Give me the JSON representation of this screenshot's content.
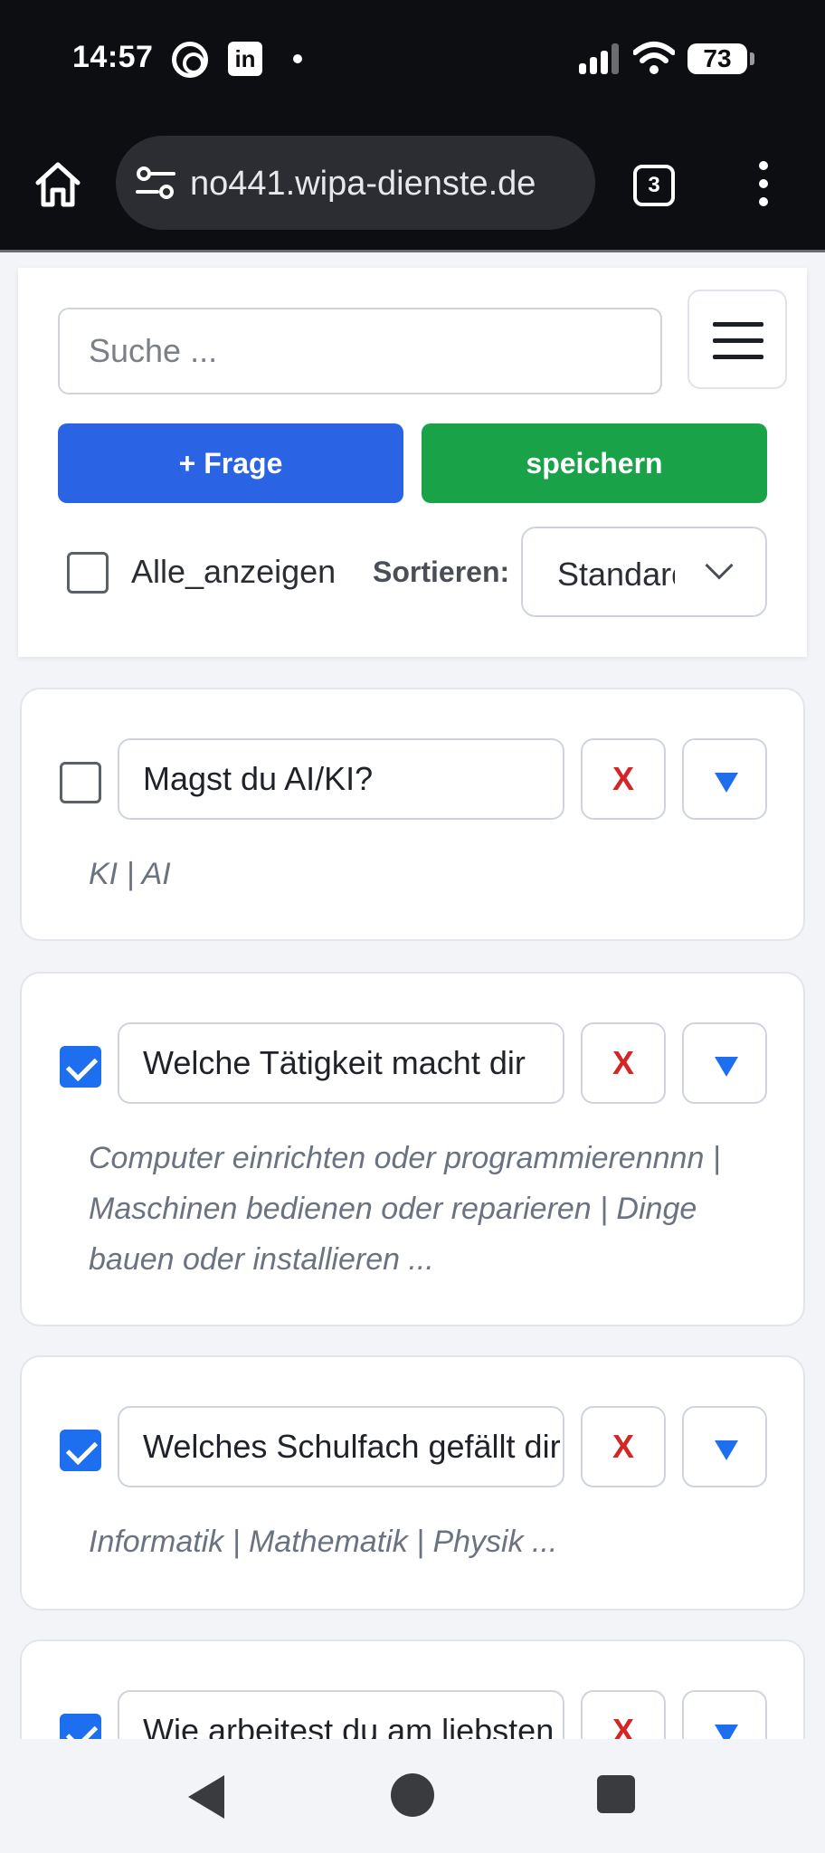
{
  "status_bar": {
    "time": "14:57",
    "battery": "73",
    "icons": [
      "threads-icon",
      "linkedin-icon",
      "notification-dot-icon",
      "signal-icon",
      "wifi-icon",
      "battery-icon"
    ],
    "linkedin_glyph": "in"
  },
  "browser": {
    "url": "no441.wipa-dienste.de",
    "tab_count": "3"
  },
  "toolbar": {
    "search_placeholder": "Suche ...",
    "add_question_label": "+ Frage",
    "save_label": "speichern",
    "show_all_label": "Alle_anzeigen",
    "show_all_checked": false,
    "sort_label": "Sortieren:",
    "sort_value": "Standard"
  },
  "questions": [
    {
      "checked": false,
      "text": "Magst du AI/KI?",
      "delete_label": "X",
      "answers": "KI | AI"
    },
    {
      "checked": true,
      "text": "Welche Tätigkeit macht dir",
      "delete_label": "X",
      "answers": "Computer einrichten oder programmierennnn | Maschinen bedienen oder reparieren | Dinge bauen oder installieren ..."
    },
    {
      "checked": true,
      "text": "Welches Schulfach gefällt dir",
      "delete_label": "X",
      "answers": "Informatik | Mathematik | Physik ..."
    },
    {
      "checked": true,
      "text": "Wie arbeitest du am liebsten",
      "delete_label": "X",
      "answers": ""
    }
  ],
  "colors": {
    "primary": "#2a64e5",
    "success": "#1aa249",
    "danger": "#d32626",
    "checkbox_checked": "#1e6ef0"
  }
}
